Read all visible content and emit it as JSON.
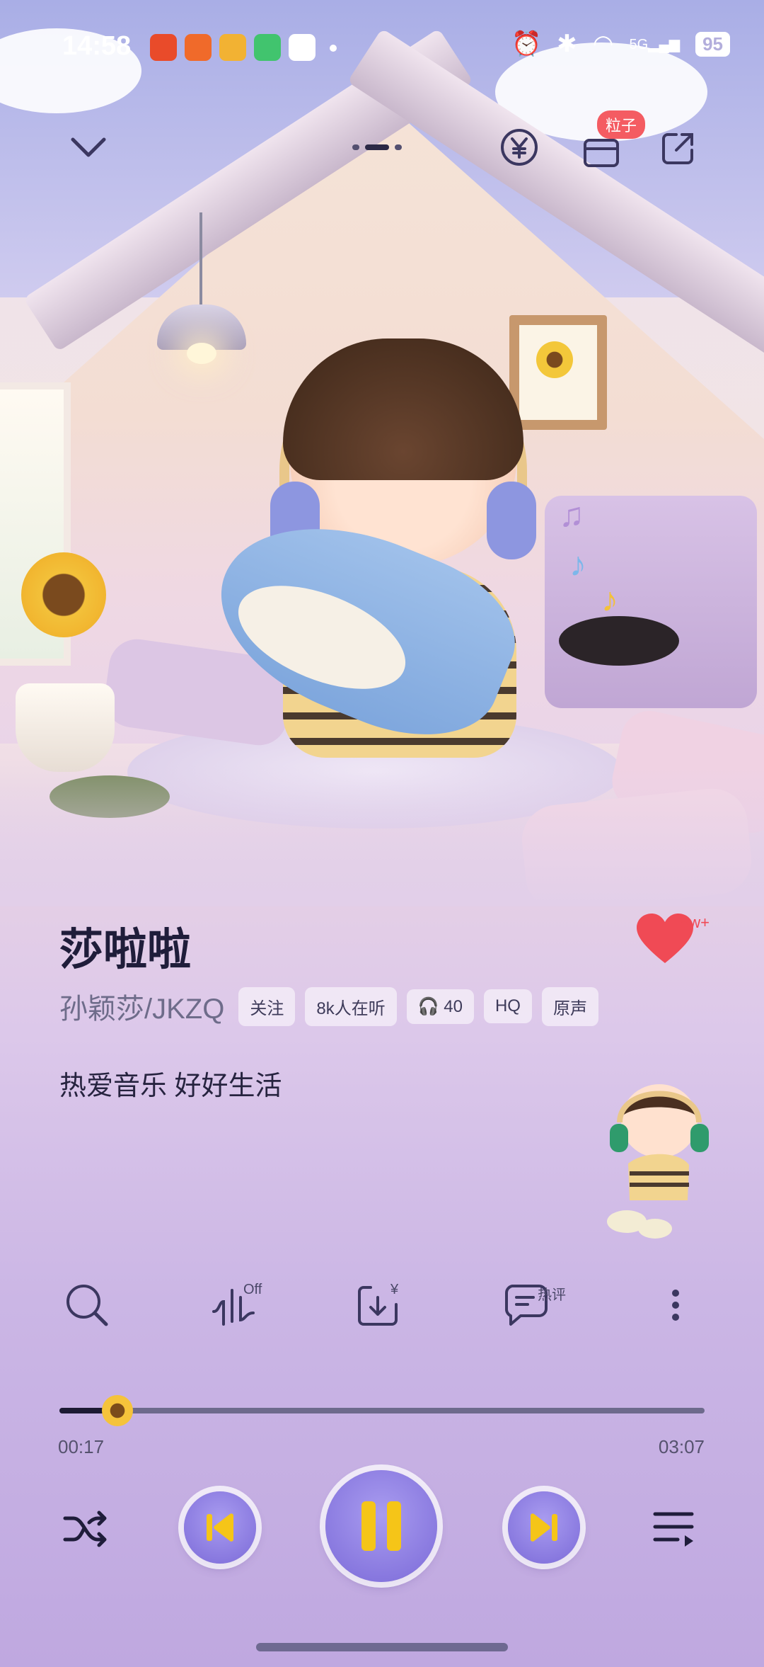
{
  "status_bar": {
    "time": "14:58",
    "app_icons": [
      "#e94b2a",
      "#f06a2a",
      "#f2b233",
      "#41c46e",
      "#ffffff"
    ],
    "network": "5G",
    "battery": "95"
  },
  "top_bar": {
    "badge": "粒子"
  },
  "song": {
    "title": "莎啦啦",
    "artist": "孙颖莎/JKZQ",
    "likes": "5w+",
    "chips": [
      "关注",
      "8k人在听",
      "🎧 40",
      "HQ",
      "原声"
    ],
    "slogan": "热爱音乐 好好生活"
  },
  "actions": {
    "effect_label": "Off",
    "download_label": "¥",
    "comment_label": "热评"
  },
  "progress": {
    "current": "00:17",
    "total": "03:07",
    "fraction": 0.09
  },
  "colors": {
    "accent": "#f5c518",
    "button": "#8b7ce0",
    "like": "#f04a55"
  }
}
